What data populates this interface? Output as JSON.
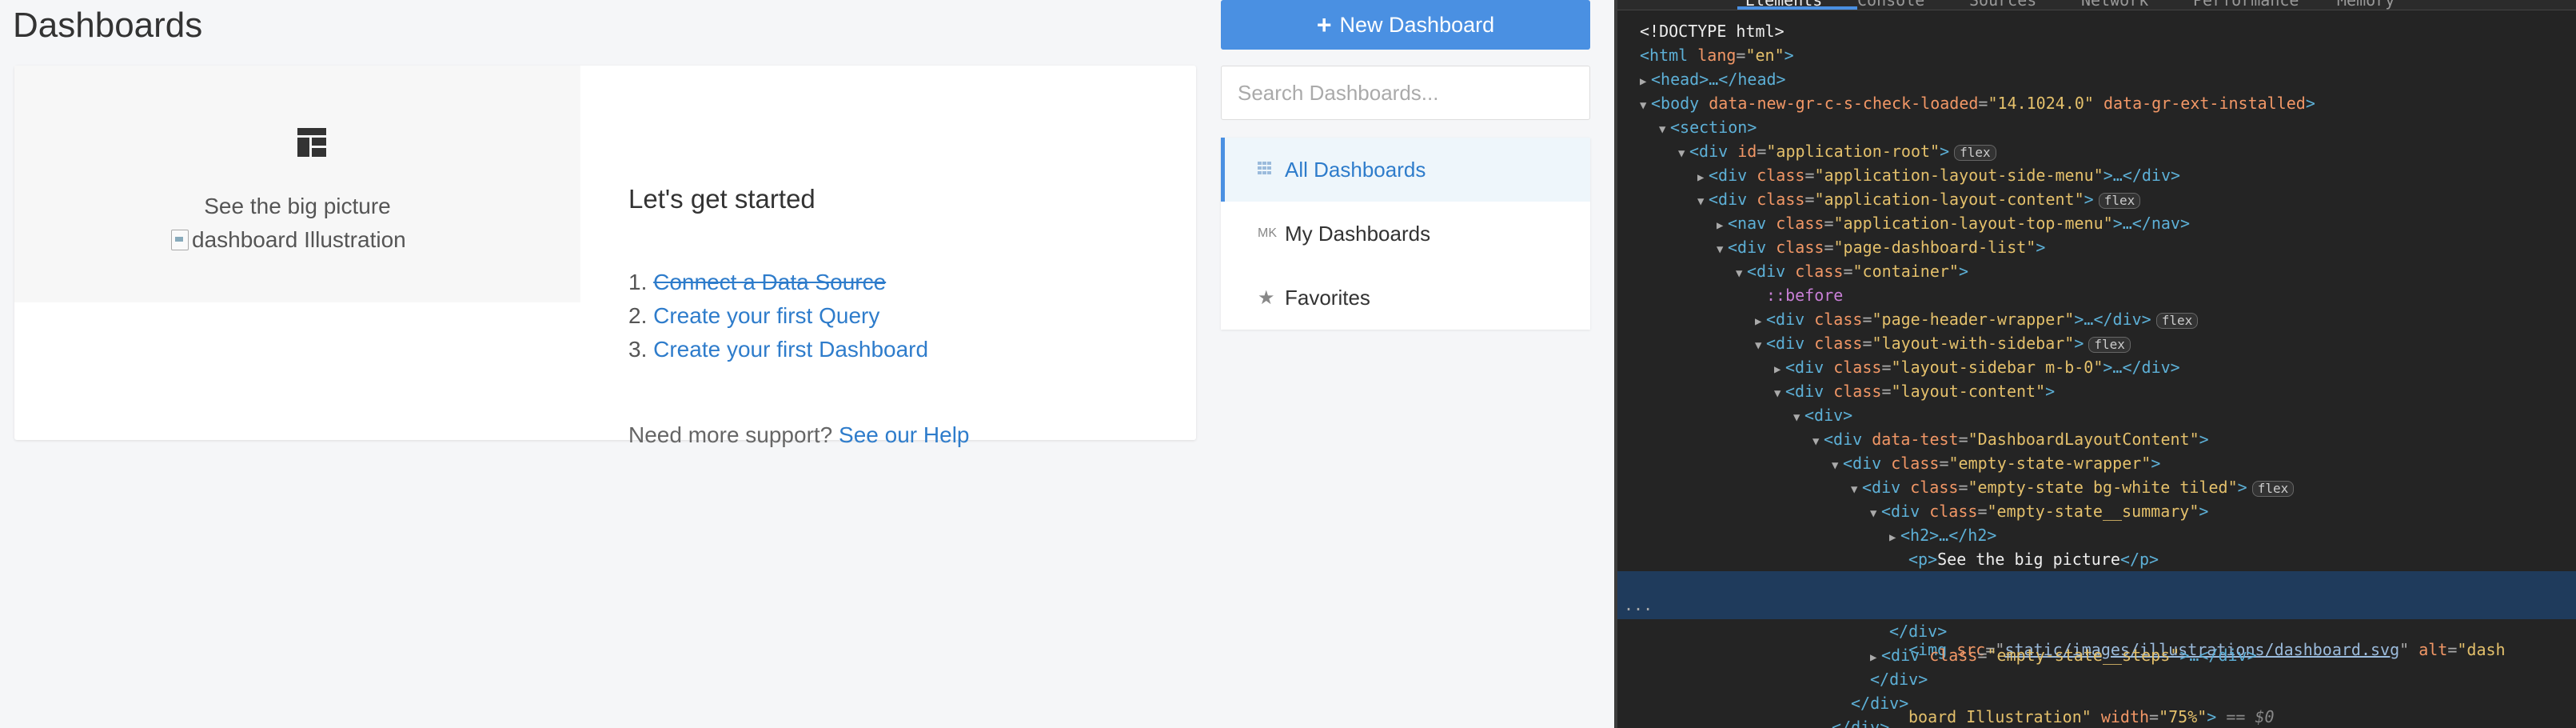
{
  "page": {
    "title": "Dashboards"
  },
  "empty_state": {
    "summary_text": "See the big picture",
    "image_alt": "dashboard Illustration",
    "heading": "Let's get started",
    "steps": [
      {
        "num": "1.",
        "label": "Connect a Data Source"
      },
      {
        "num": "2.",
        "label": "Create your first Query"
      },
      {
        "num": "3.",
        "label": "Create your first Dashboard"
      }
    ],
    "support_text": "Need more support?",
    "support_link": "See our Help"
  },
  "sidebar": {
    "new_button": "New Dashboard",
    "search_placeholder": "Search Dashboards...",
    "items": [
      {
        "label": "All Dashboards",
        "icon": "grid-icon"
      },
      {
        "label": "My Dashboards",
        "icon": "user-initials-icon",
        "icon_text": "MK"
      },
      {
        "label": "Favorites",
        "icon": "star-icon"
      }
    ]
  },
  "devtools": {
    "tabs": [
      "Elements",
      "Console",
      "Sources",
      "Network",
      "Performance",
      "Memory"
    ],
    "lines": {
      "l1": "<!DOCTYPE html>",
      "l2_tag": "<html ",
      "l2_attr": "lang",
      "l2_val": "\"en\"",
      "l2_end": ">",
      "l3": "<head>…</head>",
      "l4_tag": "<body ",
      "l4_attr1": "data-new-gr-c-s-check-loaded",
      "l4_val1": "\"14.1024.0\"",
      "l4_attr2": " data-gr-ext-installed",
      "l4_end": ">",
      "l5": "<section>",
      "l6_tag": "<div ",
      "l6_attr": "id",
      "l6_val": "\"application-root\"",
      "l6_end": ">",
      "l7_tag": "<div ",
      "l7_attr": "class",
      "l7_val": "\"application-layout-side-menu\"",
      "l7_end": ">…</div>",
      "l8_tag": "<div ",
      "l8_attr": "class",
      "l8_val": "\"application-layout-content\"",
      "l8_end": ">",
      "l9_tag": "<nav ",
      "l9_attr": "class",
      "l9_val": "\"application-layout-top-menu\"",
      "l9_end": ">…</nav>",
      "l10_tag": "<div ",
      "l10_attr": "class",
      "l10_val": "\"page-dashboard-list\"",
      "l10_end": ">",
      "l11_tag": "<div ",
      "l11_attr": "class",
      "l11_val": "\"container\"",
      "l11_end": ">",
      "l12": "::before",
      "l13_tag": "<div ",
      "l13_attr": "class",
      "l13_val": "\"page-header-wrapper\"",
      "l13_end": ">…</div>",
      "l14_tag": "<div ",
      "l14_attr": "class",
      "l14_val": "\"layout-with-sidebar\"",
      "l14_end": ">",
      "l15_tag": "<div ",
      "l15_attr": "class",
      "l15_val": "\"layout-sidebar m-b-0\"",
      "l15_end": ">…</div>",
      "l16_tag": "<div ",
      "l16_attr": "class",
      "l16_val": "\"layout-content\"",
      "l16_end": ">",
      "l17": "<div>",
      "l18_tag": "<div ",
      "l18_attr": "data-test",
      "l18_val": "\"DashboardLayoutContent\"",
      "l18_end": ">",
      "l19_tag": "<div ",
      "l19_attr": "class",
      "l19_val": "\"empty-state-wrapper\"",
      "l19_end": ">",
      "l20_tag": "<div ",
      "l20_attr": "class",
      "l20_val": "\"empty-state bg-white tiled\"",
      "l20_end": ">",
      "l21_tag": "<div ",
      "l21_attr": "class",
      "l21_val": "\"empty-state__summary\"",
      "l21_end": ">",
      "l22": "<h2>…</h2>",
      "l23_open": "<p>",
      "l23_text": "See the big picture",
      "l23_close": "</p>",
      "l24_tag": "<img ",
      "l24_attr1": "src",
      "l24_link": "static/images/illustrations/dashboard.svg",
      "l24_attr2": " alt",
      "l24_val2a": "\"dash",
      "l24b_val": "board Illustration\"",
      "l24b_attr": " width",
      "l24b_val2": "\"75%\"",
      "l24b_end": ">",
      "l24b_dollar": " == $0",
      "l25": "</div>",
      "l26_tag": "<div ",
      "l26_attr": "class",
      "l26_val": "\"empty-state__steps\"",
      "l26_end": ">…</div>",
      "l27": "</div>",
      "l28": "</div>",
      "l29": "</div>"
    },
    "badge_flex": "flex",
    "ellipsis": "..."
  }
}
